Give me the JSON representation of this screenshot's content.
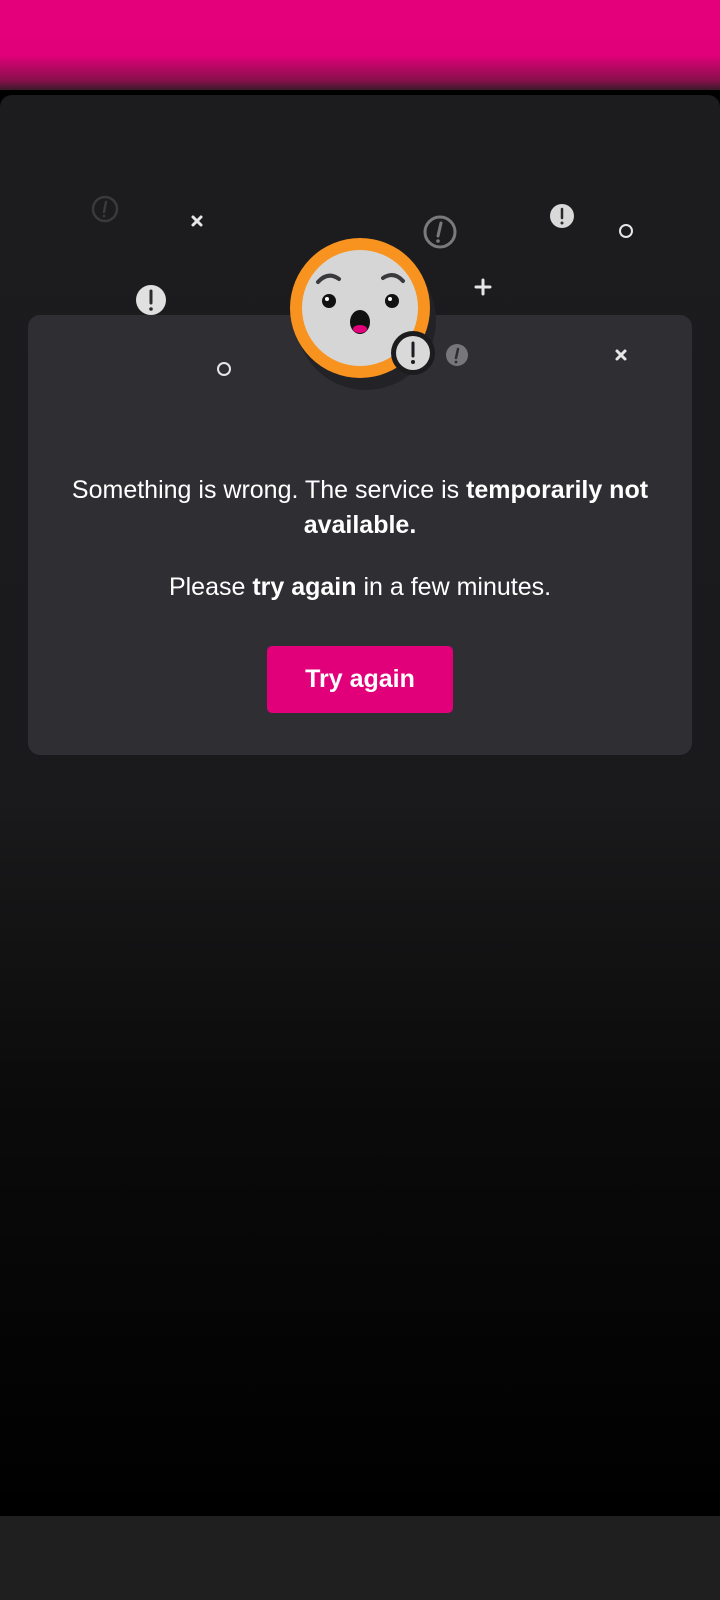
{
  "header": {
    "brand_color": "#e2007a"
  },
  "error": {
    "message_prefix": "Something is wrong. The service is ",
    "message_bold": "temporarily not available.",
    "retry_prefix": "Please ",
    "retry_bold": "try again",
    "retry_suffix": " in a few minutes.",
    "button_label": "Try again"
  },
  "illustration": {
    "face_icon": "surprised-face-icon",
    "ring_color": "#f7931e",
    "decorations": [
      "exclamation-icon",
      "cross-icon",
      "plus-icon",
      "circle-icon"
    ]
  }
}
